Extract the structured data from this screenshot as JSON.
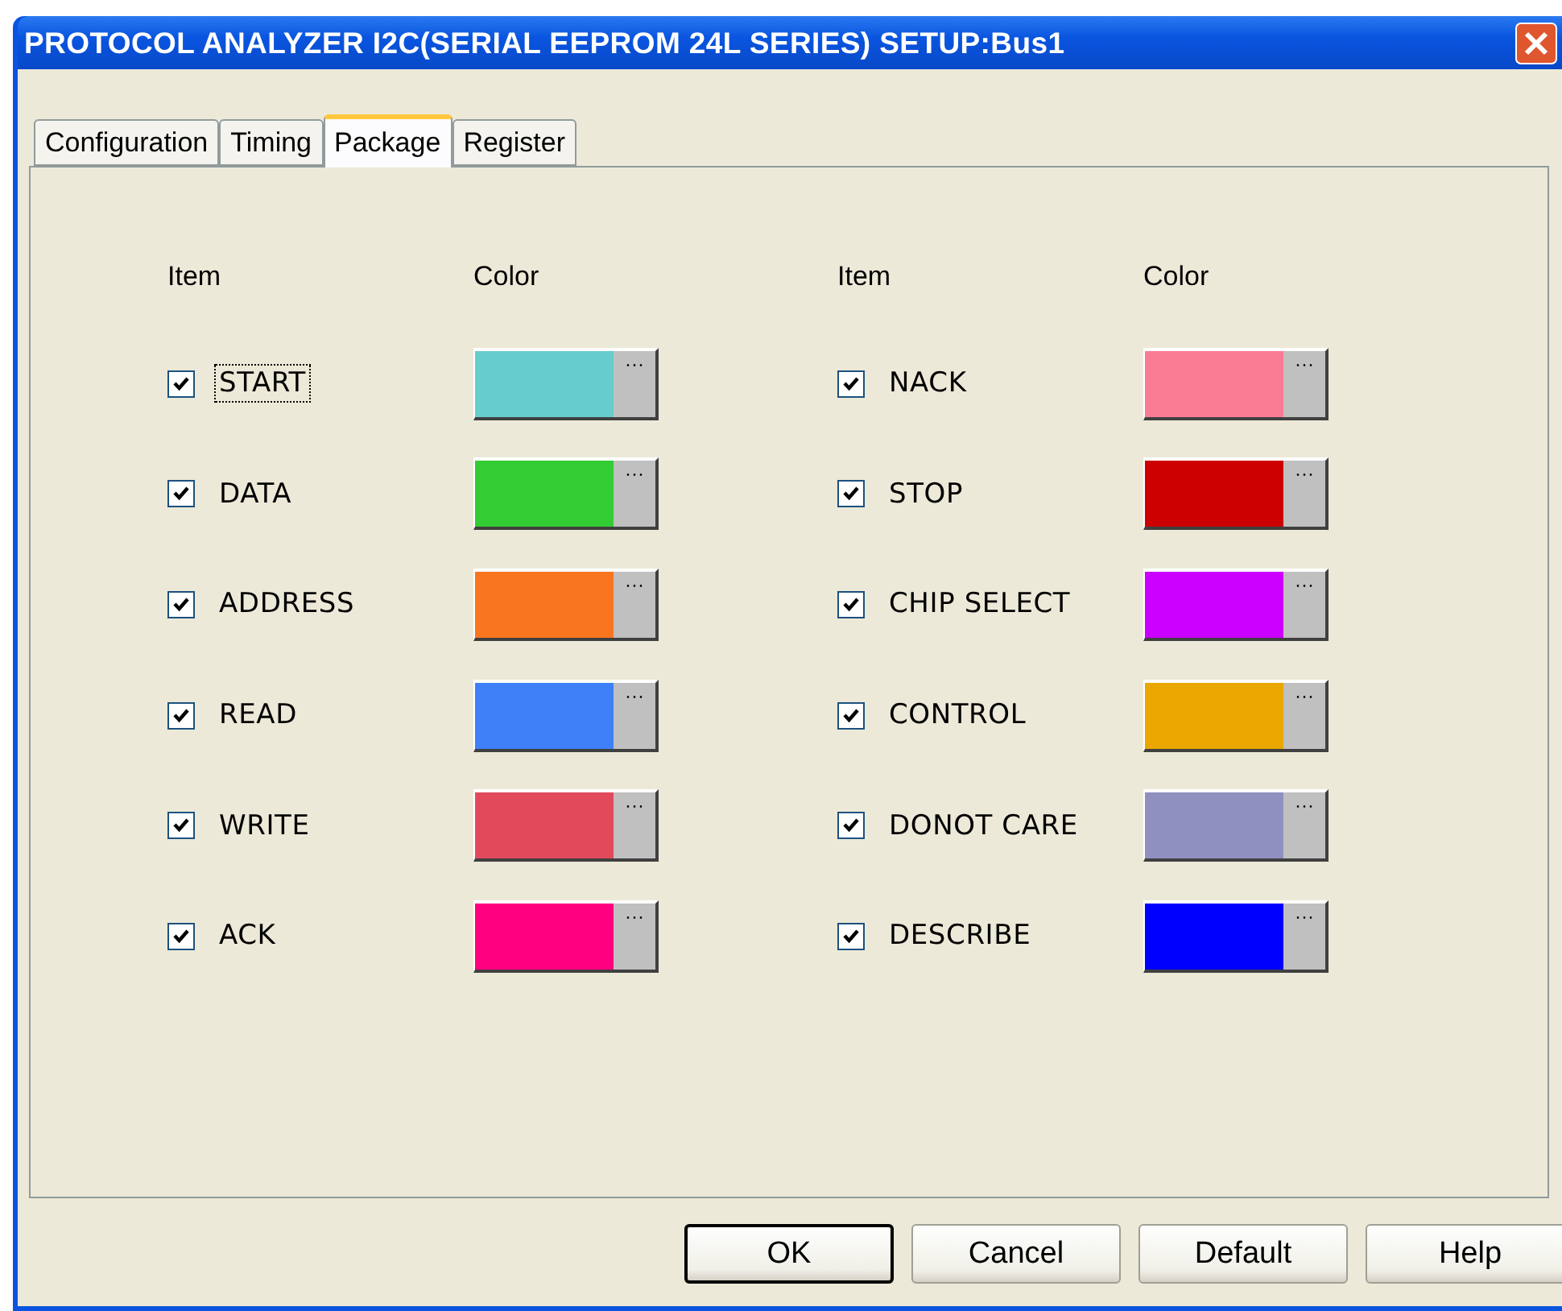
{
  "window": {
    "title": "PROTOCOL ANALYZER I2C(SERIAL EEPROM 24L SERIES) SETUP:Bus1"
  },
  "tabs": [
    {
      "label": "Configuration",
      "selected": false
    },
    {
      "label": "Timing",
      "selected": false
    },
    {
      "label": "Package",
      "selected": true
    },
    {
      "label": "Register",
      "selected": false
    }
  ],
  "groups": [
    {
      "headers": [
        "Item",
        "Color"
      ],
      "items": [
        {
          "label": "START",
          "checked": true,
          "focused": true,
          "color": "#66cccc"
        },
        {
          "label": "DATA",
          "checked": true,
          "focused": false,
          "color": "#33cc33"
        },
        {
          "label": "ADDRESS",
          "checked": true,
          "focused": false,
          "color": "#f97520"
        },
        {
          "label": "READ",
          "checked": true,
          "focused": false,
          "color": "#3f80f8"
        },
        {
          "label": "WRITE",
          "checked": true,
          "focused": false,
          "color": "#e24a5c"
        },
        {
          "label": "ACK",
          "checked": true,
          "focused": false,
          "color": "#ff0080"
        }
      ]
    },
    {
      "headers": [
        "Item",
        "Color"
      ],
      "items": [
        {
          "label": "NACK",
          "checked": true,
          "focused": false,
          "color": "#f97c94"
        },
        {
          "label": "STOP",
          "checked": true,
          "focused": false,
          "color": "#cc0000"
        },
        {
          "label": "CHIP SELECT",
          "checked": true,
          "focused": false,
          "color": "#cc00ff"
        },
        {
          "label": "CONTROL",
          "checked": true,
          "focused": false,
          "color": "#eaa700"
        },
        {
          "label": "DONOT CARE",
          "checked": true,
          "focused": false,
          "color": "#9090c0"
        },
        {
          "label": "DESCRIBE",
          "checked": true,
          "focused": false,
          "color": "#0000ff"
        }
      ]
    }
  ],
  "color_button_text": "···",
  "buttons": [
    {
      "label": "OK",
      "default": true
    },
    {
      "label": "Cancel",
      "default": false
    },
    {
      "label": "Default",
      "default": false
    },
    {
      "label": "Help",
      "default": false
    }
  ]
}
